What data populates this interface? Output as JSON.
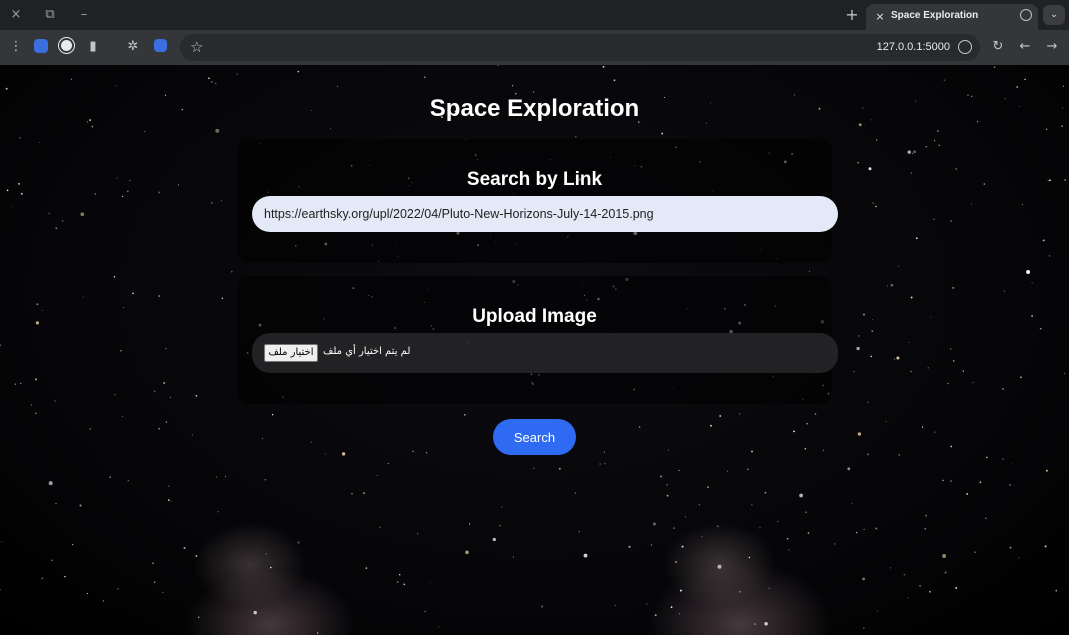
{
  "browser": {
    "tab_title": "Space Exploration",
    "url": "127.0.0.1:5000",
    "icons": {
      "close": "×",
      "new_tab": "+",
      "minimize": "–",
      "restore": "⧉",
      "back": "←",
      "forward": "→",
      "reload": "↻",
      "menu": "⋮",
      "star": "☆",
      "tab_list": "⌄"
    }
  },
  "page": {
    "title": "Space Exploration",
    "link_section": {
      "heading": "Search by Link",
      "input_value": "https://earthsky.org/upl/2022/04/Pluto-New-Horizons-July-14-2015.png"
    },
    "upload_section": {
      "heading": "Upload Image",
      "choose_button": "اختيار ملف",
      "no_file_text": "لم يتم اختيار أي ملف"
    },
    "search_button": "Search"
  },
  "colors": {
    "accent": "#2f6bf2",
    "input_bg": "#e4e9f7",
    "panel_bg": "rgba(0,0,0,0.55)"
  }
}
